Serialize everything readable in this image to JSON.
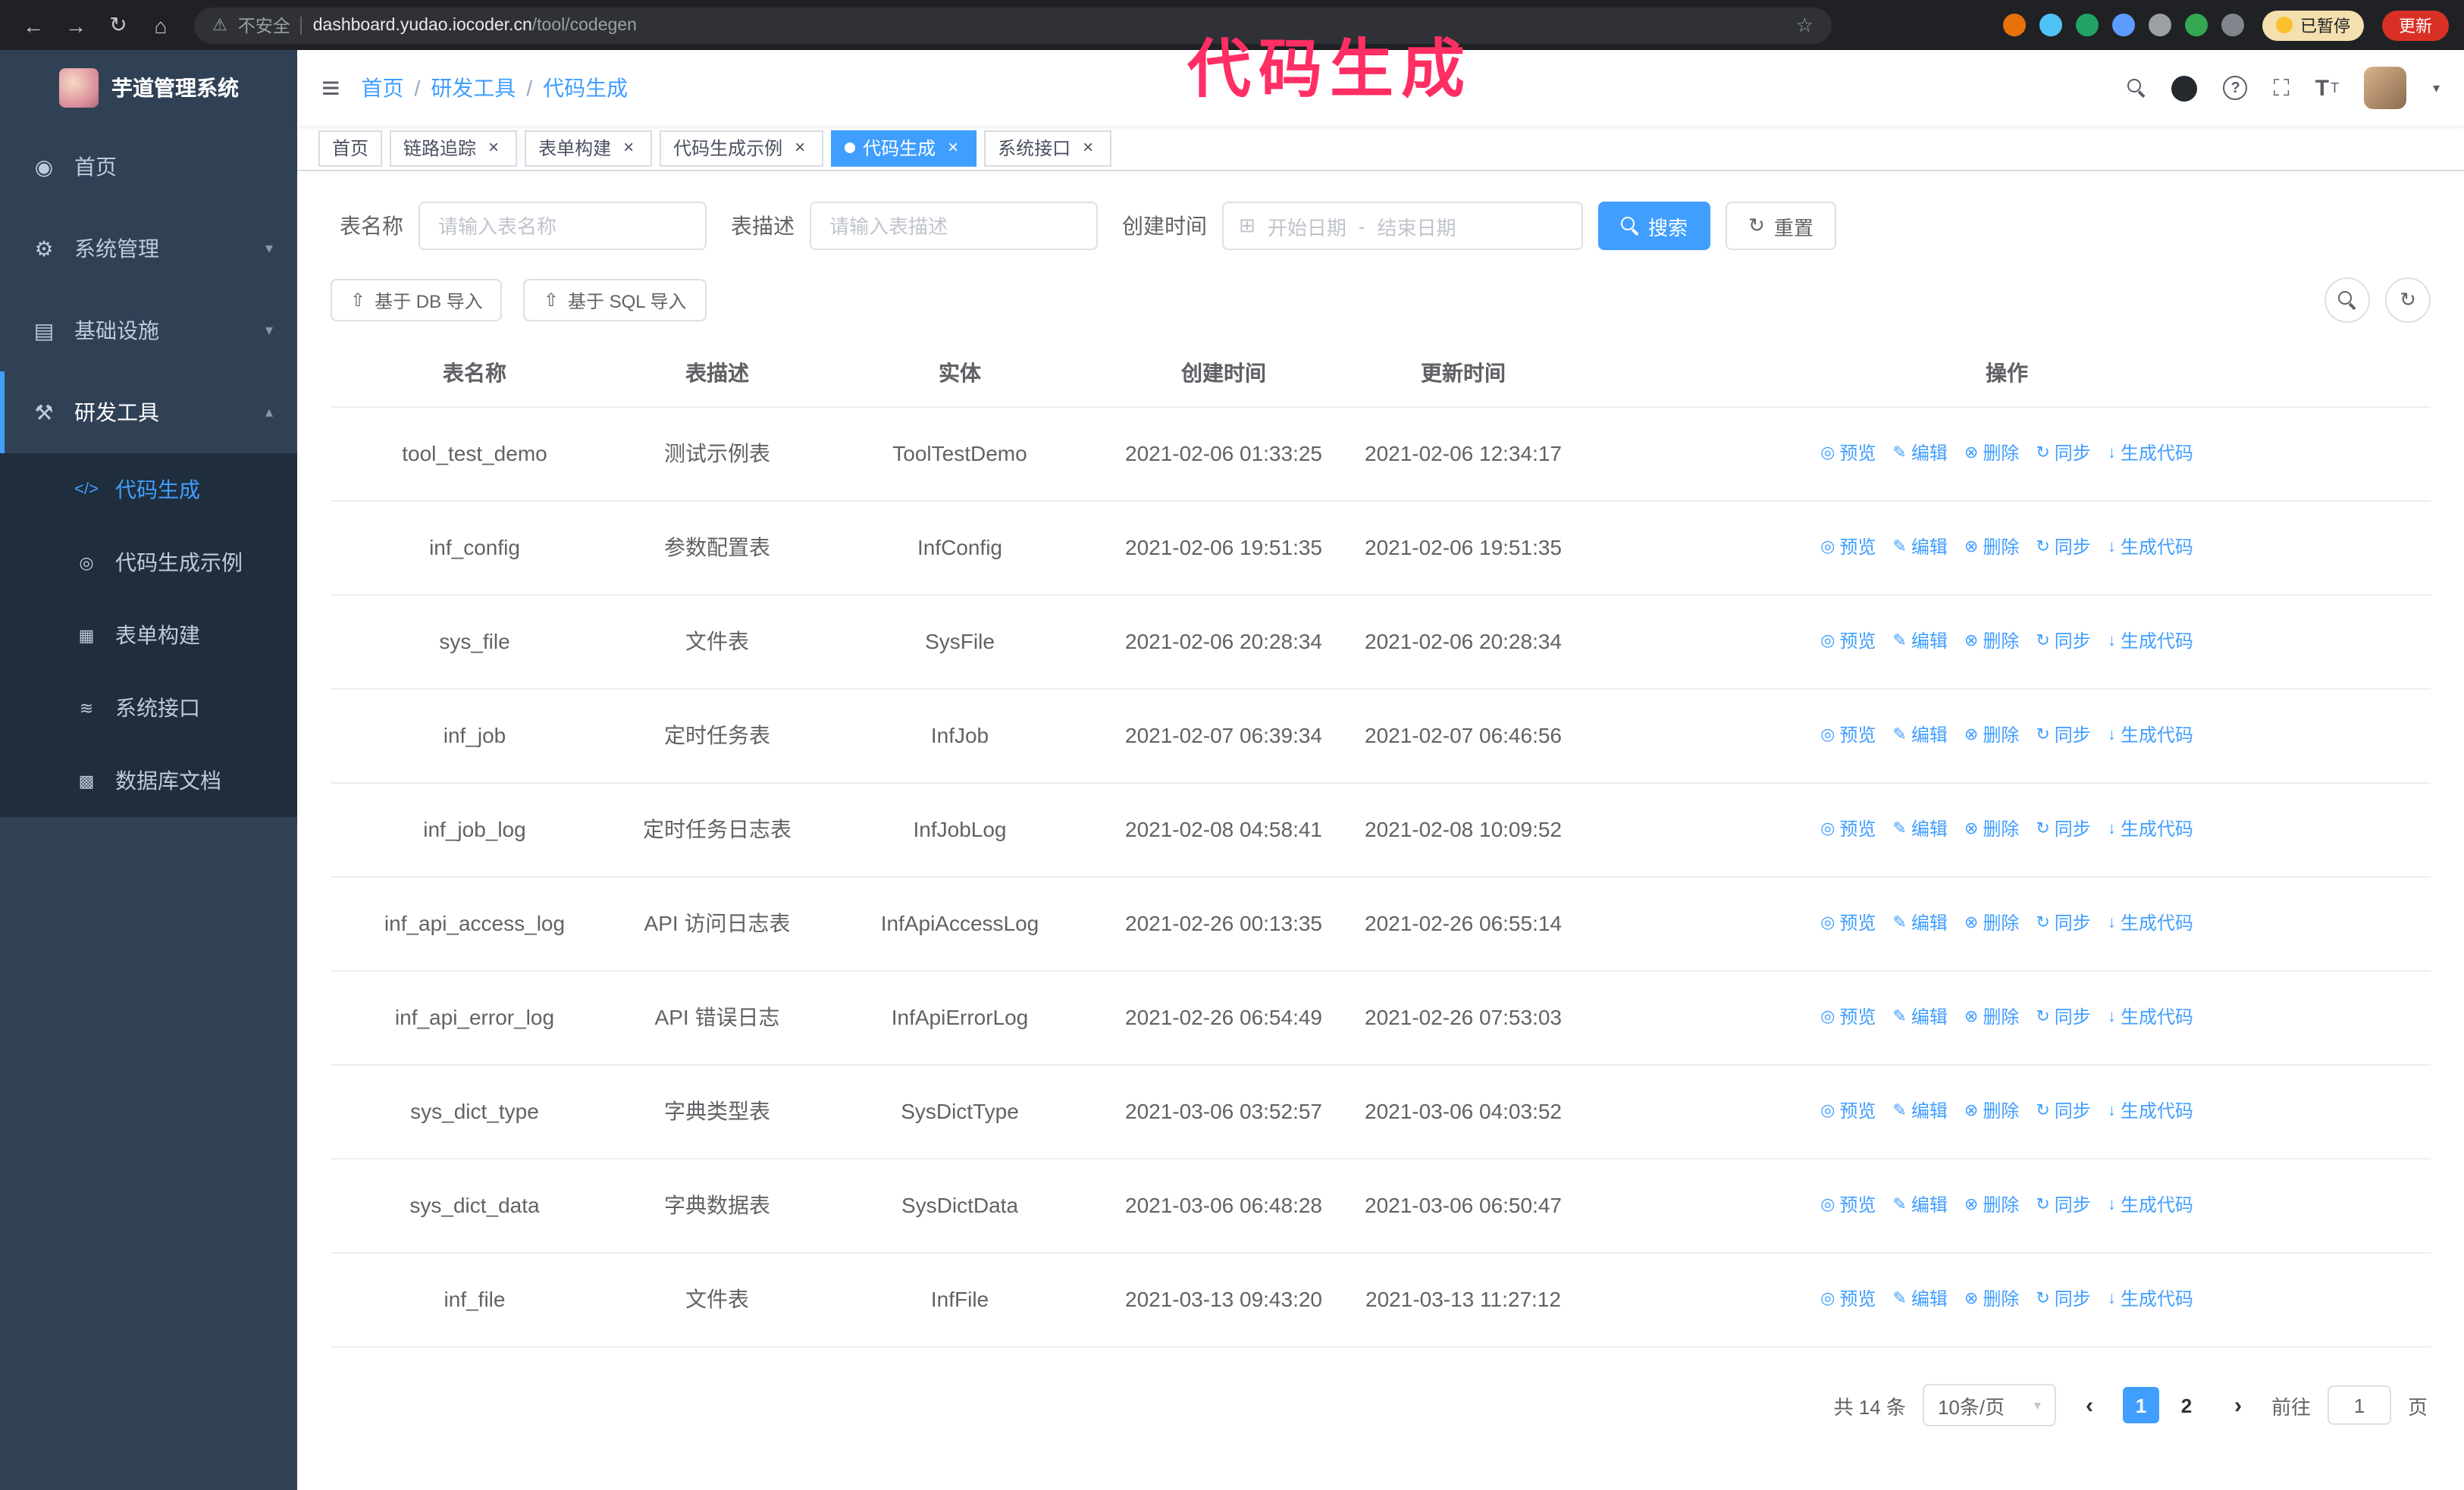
{
  "colors": {
    "accent": "#409eff",
    "sidebar": "#304156",
    "submenu": "#1f2d3d",
    "chrome": "#202124",
    "omnibox": "#2f3136",
    "update": "#d93025",
    "paused": "#f3e0ae",
    "annotation": "#ff2e63"
  },
  "browser": {
    "nav": {
      "back": "←",
      "forward": "→",
      "reload": "↻",
      "home": "⌂"
    },
    "warning_glyph": "⚠",
    "security_label": "不安全",
    "url_domain": "dashboard.yudao.iocoder.cn",
    "url_path": "/tool/codegen",
    "star_glyph": "☆",
    "extensions": [
      {
        "color": "#e8710a"
      },
      {
        "color": "#4fc3f7"
      },
      {
        "color": "#21a366"
      },
      {
        "color": "#5c9cff"
      },
      {
        "color": "#9aa0a6"
      },
      {
        "color": "#34a853"
      },
      {
        "color": "#80868b"
      }
    ],
    "paused_badge": "已暂停",
    "update_button": "更新"
  },
  "annotation": "代码生成",
  "sidebar": {
    "logo_title": "芋道管理系统",
    "items": [
      {
        "label": "首页",
        "glyph": "◉",
        "chevron": ""
      },
      {
        "label": "系统管理",
        "glyph": "⚙",
        "chevron": "▾"
      },
      {
        "label": "基础设施",
        "glyph": "▤",
        "chevron": "▾"
      },
      {
        "label": "研发工具",
        "glyph": "⚒",
        "chevron": "▴",
        "active": true
      }
    ],
    "submenu": [
      {
        "label": "代码生成",
        "glyph": "</>",
        "active": true
      },
      {
        "label": "代码生成示例",
        "glyph": "◎"
      },
      {
        "label": "表单构建",
        "glyph": "▦"
      },
      {
        "label": "系统接口",
        "glyph": "≋"
      },
      {
        "label": "数据库文档",
        "glyph": "▩"
      }
    ]
  },
  "header": {
    "hamburger_glyph": "≡",
    "breadcrumb": [
      {
        "label": "首页",
        "sep": "/"
      },
      {
        "label": "研发工具",
        "sep": "/"
      },
      {
        "label": "代码生成",
        "sep": ""
      }
    ],
    "tools": {
      "help_glyph": "?",
      "fullscreen_glyph": "⛶",
      "fontsize_glyph": "T",
      "fontsize_glyph_small": "T",
      "caret_glyph": "▾"
    }
  },
  "tabs": {
    "close_glyph": "×",
    "items": [
      {
        "label": "首页"
      },
      {
        "label": "链路追踪",
        "closable": true
      },
      {
        "label": "表单构建",
        "closable": true
      },
      {
        "label": "代码生成示例",
        "closable": true
      },
      {
        "label": "代码生成",
        "closable": true,
        "active": true
      },
      {
        "label": "系统接口",
        "closable": true
      }
    ]
  },
  "filters": {
    "name_label": "表名称",
    "name_placeholder": "请输入表名称",
    "desc_label": "表描述",
    "desc_placeholder": "请输入表描述",
    "time_label": "创建时间",
    "calendar_glyph": "⊞",
    "start_placeholder": "开始日期",
    "range_sep": "-",
    "end_placeholder": "结束日期",
    "search_button": "搜索",
    "reset_button": "重置",
    "reset_glyph": "↻"
  },
  "toolbar": {
    "upload_glyph": "⇧",
    "import_db": "基于 DB 导入",
    "import_sql": "基于 SQL 导入",
    "refresh_glyph": "↻"
  },
  "table": {
    "columns": [
      "表名称",
      "表描述",
      "实体",
      "创建时间",
      "更新时间",
      "操作"
    ],
    "actions": [
      {
        "label": "预览",
        "glyph": "◎"
      },
      {
        "label": "编辑",
        "glyph": "✎"
      },
      {
        "label": "删除",
        "glyph": "⊗"
      },
      {
        "label": "同步",
        "glyph": "↻"
      },
      {
        "label": "生成代码",
        "glyph": "↓"
      }
    ],
    "rows": [
      {
        "name": "tool_test_demo",
        "desc": "测试示例表",
        "entity": "ToolTestDemo",
        "created": "2021-02-06 01:33:25",
        "updated": "2021-02-06 12:34:17"
      },
      {
        "name": "inf_config",
        "desc": "参数配置表",
        "entity": "InfConfig",
        "created": "2021-02-06 19:51:35",
        "updated": "2021-02-06 19:51:35"
      },
      {
        "name": "sys_file",
        "desc": "文件表",
        "entity": "SysFile",
        "created": "2021-02-06 20:28:34",
        "updated": "2021-02-06 20:28:34"
      },
      {
        "name": "inf_job",
        "desc": "定时任务表",
        "entity": "InfJob",
        "created": "2021-02-07 06:39:34",
        "updated": "2021-02-07 06:46:56"
      },
      {
        "name": "inf_job_log",
        "desc": "定时任务日志表",
        "entity": "InfJobLog",
        "created": "2021-02-08 04:58:41",
        "updated": "2021-02-08 10:09:52"
      },
      {
        "name": "inf_api_access_log",
        "desc": "API 访问日志表",
        "entity": "InfApiAccessLog",
        "created": "2021-02-26 00:13:35",
        "updated": "2021-02-26 06:55:14"
      },
      {
        "name": "inf_api_error_log",
        "desc": "API 错误日志",
        "entity": "InfApiErrorLog",
        "created": "2021-02-26 06:54:49",
        "updated": "2021-02-26 07:53:03"
      },
      {
        "name": "sys_dict_type",
        "desc": "字典类型表",
        "entity": "SysDictType",
        "created": "2021-03-06 03:52:57",
        "updated": "2021-03-06 04:03:52"
      },
      {
        "name": "sys_dict_data",
        "desc": "字典数据表",
        "entity": "SysDictData",
        "created": "2021-03-06 06:48:28",
        "updated": "2021-03-06 06:50:47"
      },
      {
        "name": "inf_file",
        "desc": "文件表",
        "entity": "InfFile",
        "created": "2021-03-13 09:43:20",
        "updated": "2021-03-13 11:27:12"
      }
    ]
  },
  "pagination": {
    "total": "共 14 条",
    "page_size": "10条/页",
    "select_caret": "▾",
    "prev_glyph": "‹",
    "next_glyph": "›",
    "pages": [
      {
        "label": "1",
        "active": true
      },
      {
        "label": "2"
      }
    ],
    "goto_label": "前往",
    "goto_value": "1",
    "page_unit": "页"
  }
}
